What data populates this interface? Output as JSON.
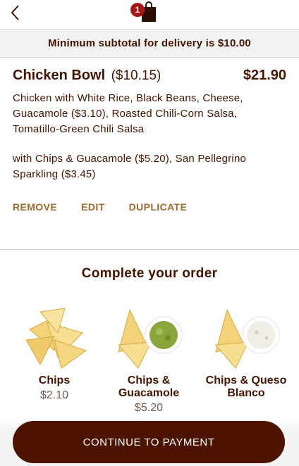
{
  "header": {
    "cart_count": "1"
  },
  "notice": {
    "text": "Minimum subtotal for delivery is $10.00"
  },
  "item": {
    "name": "Chicken Bowl",
    "base_price": "($10.15)",
    "total": "$21.90",
    "description": "Chicken with White Rice, Black Beans, Cheese, Guacamole ($3.10), Roasted Chili-Corn Salsa, Tomatillo-Green Chili Salsa",
    "extras": "with Chips & Guacamole ($5.20), San Pellegrino Sparkling  ($3.45)",
    "actions": {
      "remove": "REMOVE",
      "edit": "EDIT",
      "duplicate": "DUPLICATE"
    }
  },
  "upsell": {
    "title": "Complete your order",
    "items": [
      {
        "name": "Chips",
        "price": "$2.10"
      },
      {
        "name": "Chips & Guacamole",
        "price": "$5.20"
      },
      {
        "name": "Chips & Queso Blanco",
        "price": ""
      }
    ]
  },
  "cta": {
    "label": "CONTINUE TO PAYMENT"
  },
  "colors": {
    "brand": "#451400",
    "accent": "#a06a2e",
    "badge": "#a81612",
    "button": "#4b1300"
  }
}
